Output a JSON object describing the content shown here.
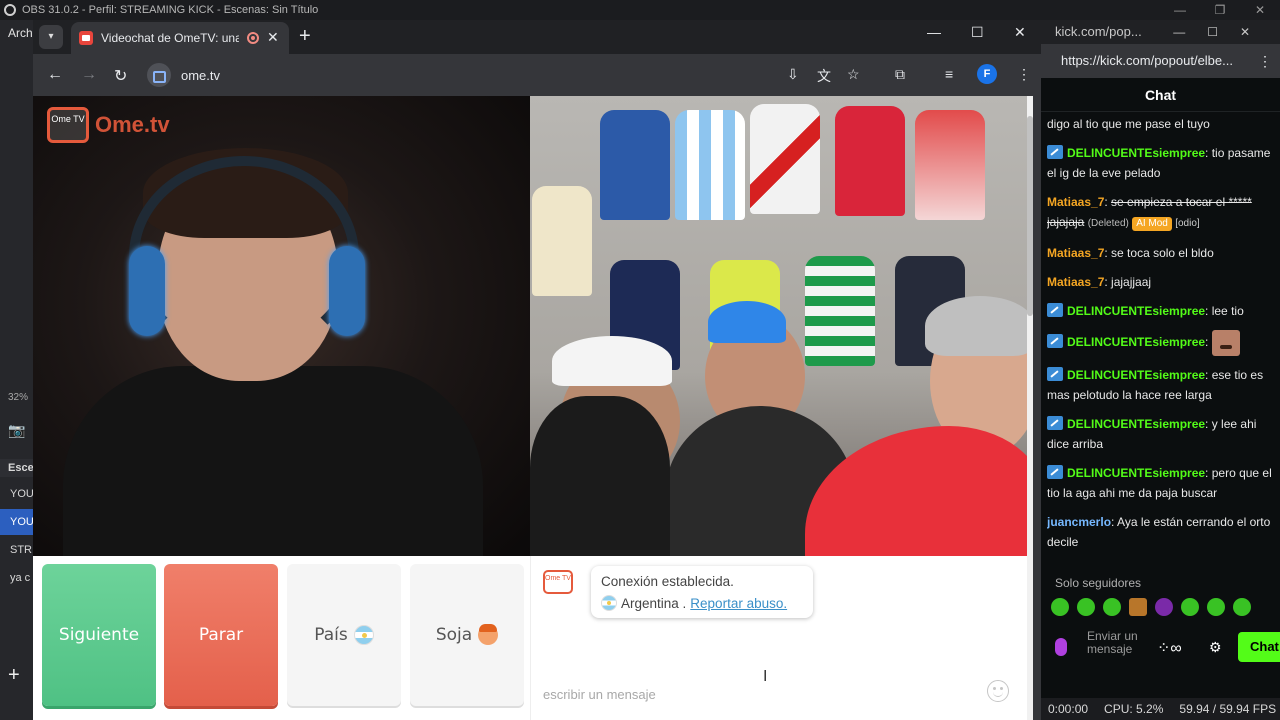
{
  "obs": {
    "title": "OBS 31.0.2 - Perfil: STREAMING KICK - Escenas: Sin Título",
    "menu_first": "Arch",
    "percent": "32%",
    "scenes_header": "Esce",
    "scenes": [
      "YOU",
      "YOU",
      "STRI",
      "ya c"
    ],
    "add_button": "+",
    "status": {
      "time": "0:00:00",
      "cpu": "CPU: 5.2%",
      "fps": "59.94 / 59.94 FPS"
    }
  },
  "browser": {
    "tab_title": "Videochat de OmeTV: una",
    "url": "ome.tv",
    "profile_initial": "F"
  },
  "ometv": {
    "logo_badge": "Ome TV",
    "logo_text": "Ome.tv",
    "buttons": {
      "next": "Siguiente",
      "stop": "Parar",
      "country": "País",
      "gender": "Soja"
    },
    "chat": {
      "logo_badge": "Ome TV",
      "status": "Conexión establecida.",
      "country": "Argentina .",
      "report_link": "Reportar abuso.",
      "input_placeholder": "escribir un mensaje"
    }
  },
  "kick": {
    "window_title": "kick.com/pop...",
    "url": "https://kick.com/popout/elbe...",
    "chat_title": "Chat",
    "messages": [
      {
        "user": "",
        "text": "digo al tio que me pase el tuyo"
      },
      {
        "user": "DELINCUENTEsiempree",
        "text": "tio pasame el ig de la eve pelado"
      },
      {
        "user": "Matiaas_7",
        "text": "se empieza a tocar el ***** jajajaja",
        "deleted": "(Deleted)",
        "badge": "AI Mod",
        "tag": "[odio]"
      },
      {
        "user": "Matiaas_7",
        "text": "se toca solo el bldo"
      },
      {
        "user": "Matiaas_7",
        "text": "jajajjaaj"
      },
      {
        "user": "DELINCUENTEsiempree",
        "text": "lee tio"
      },
      {
        "user": "DELINCUENTEsiempree",
        "text": ""
      },
      {
        "user": "DELINCUENTEsiempree",
        "text": "ese tio es mas pelotudo la hace ree larga"
      },
      {
        "user": "DELINCUENTEsiempree",
        "text": "y lee ahi dice arriba"
      },
      {
        "user": "DELINCUENTEsiempree",
        "text": "pero que el tio la aga ahi me da paja buscar"
      },
      {
        "user": "juancmerlo",
        "text": "Aya le están cerrando el orto decile"
      }
    ],
    "followers_only": "Solo seguidores",
    "send_placeholder": "Enviar un mensaje",
    "chat_button": "Chat"
  },
  "colors": {
    "next": "#4fc184",
    "stop": "#e4604b",
    "kick_green": "#53fc18",
    "ometv_orange": "#e55a3c"
  }
}
